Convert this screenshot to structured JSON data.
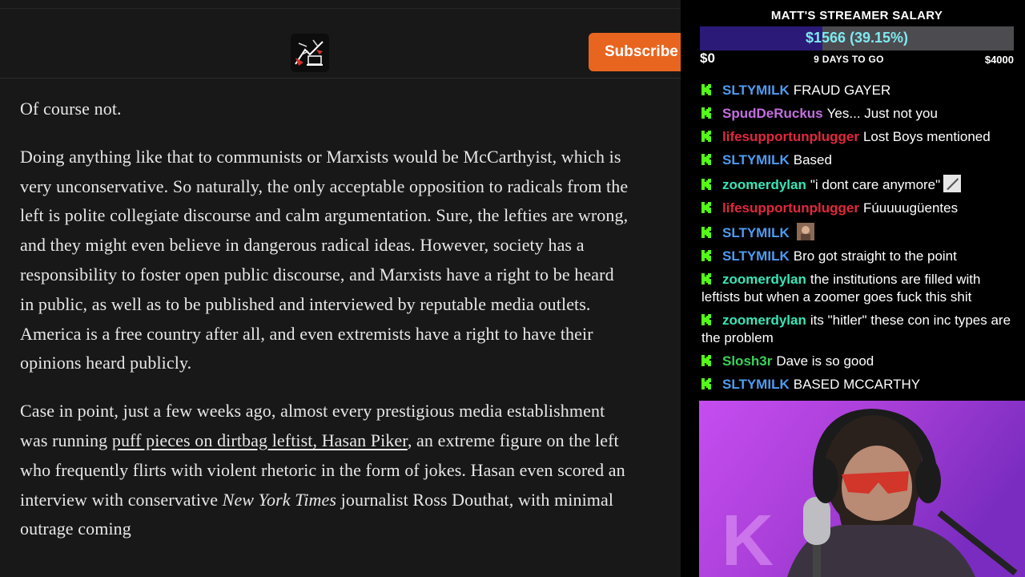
{
  "header": {
    "subscribe_label": "Subscribe"
  },
  "article": {
    "p1": "Of course not.",
    "p2": "Doing anything like that to communists or Marxists would be McCarthyist, which is very unconservative. So naturally, the only acceptable opposition to radicals from the left is polite collegiate discourse and calm argumentation. Sure, the lefties are wrong, and they might even believe in dangerous radical ideas. However, society has a responsibility to foster open public discourse, and Marxists have a right to be heard in public, as well as to be published and interviewed by reputable media outlets. America is a free country after all, and even extremists have a right to have their opinions heard publicly.",
    "p3_a": "Case in point, just a few weeks ago, almost every prestigious media establishment was running ",
    "p3_link": "puff pieces on dirtbag leftist, Hasan Piker",
    "p3_b": ", an extreme figure on the left who frequently flirts with violent rhetoric in the form of jokes. Hasan even scored an interview with conservative ",
    "p3_italic": "New York Times",
    "p3_c": " journalist Ross Douthat, with minimal outrage coming"
  },
  "goal": {
    "title": "MATT'S STREAMER SALARY",
    "amount_text": "$1566 (39.15%)",
    "progress": 0.3915,
    "min_label": "$0",
    "days_label": "9 DAYS TO GO",
    "max_label": "$4000"
  },
  "chat": {
    "messages": [
      {
        "user": "SLTYMILK",
        "text": "FRAUD GAYER",
        "color": "#4f9bf0"
      },
      {
        "user": "SpudDeRuckus",
        "text": "Yes... Just not you",
        "color": "#c36ee0"
      },
      {
        "user": "lifesupportunplugger",
        "text": "Lost Boys mentioned",
        "color": "#e3283c"
      },
      {
        "user": "SLTYMILK",
        "text": "Based",
        "color": "#4f9bf0"
      },
      {
        "user": "zoomerdylan",
        "text": "\"i dont care anymore\"",
        "color": "#38e6b8",
        "emote": "knife-emote"
      },
      {
        "user": "lifesupportunplugger",
        "text": "Fúuuuugüentes",
        "color": "#e3283c"
      },
      {
        "user": "SLTYMILK",
        "text": "",
        "color": "#4f9bf0",
        "emote": "face-emote"
      },
      {
        "user": "SLTYMILK",
        "text": "Bro got straight to the point",
        "color": "#4f9bf0"
      },
      {
        "user": "zoomerdylan",
        "text": "the institutions are filled with leftists but when a zoomer goes fuck this shit",
        "color": "#38e6b8"
      },
      {
        "user": "zoomerdylan",
        "text": "its \"hitler\" these con inc types are the problem",
        "color": "#38e6b8"
      },
      {
        "user": "Slosh3r",
        "text": "Dave is so good",
        "color": "#3ad25a"
      },
      {
        "user": "SLTYMILK",
        "text": "BASED MCCARTHY",
        "color": "#4f9bf0"
      }
    ],
    "badge_icon": "kick-badge-icon",
    "text_color": "#ffffff"
  },
  "colors": {
    "article_bg": "#181818",
    "subscribe_bg": "#e8651f",
    "goal_fill": "#2b1a78",
    "goal_text": "#7ee9f0",
    "webcam_bg": "#b43ee6"
  }
}
